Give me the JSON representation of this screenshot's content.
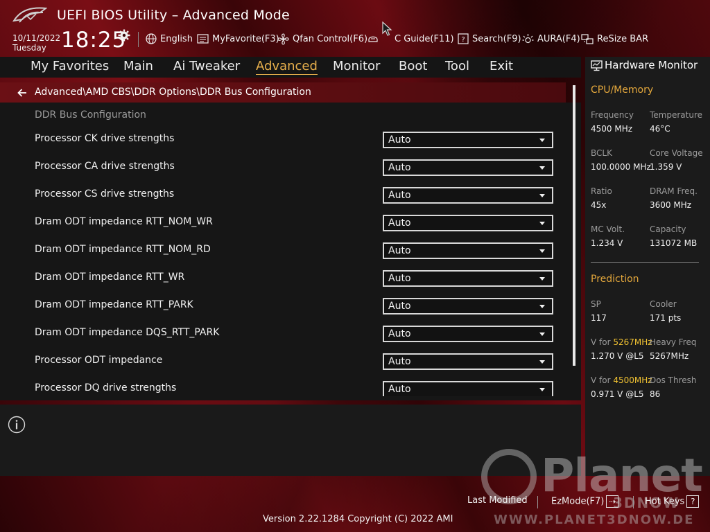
{
  "header": {
    "title": "UEFI BIOS Utility – Advanced Mode",
    "date": "10/11/2022",
    "day": "Tuesday",
    "time": "18:25",
    "tools": [
      {
        "icon": "globe-icon",
        "label": "English"
      },
      {
        "icon": "favorite-icon",
        "label": "MyFavorite(F3)"
      },
      {
        "icon": "fan-icon",
        "label": "Qfan Control(F6)"
      },
      {
        "icon": "oc-guide-icon",
        "label": "C Guide(F11)"
      },
      {
        "icon": "search-icon",
        "label": "Search(F9)"
      },
      {
        "icon": "aura-icon",
        "label": "AURA(F4)"
      },
      {
        "icon": "resize-bar-icon",
        "label": "ReSize BAR"
      }
    ]
  },
  "tabs": [
    {
      "label": "My Favorites",
      "active": false
    },
    {
      "label": "Main",
      "active": false
    },
    {
      "label": "Ai Tweaker",
      "active": false
    },
    {
      "label": "Advanced",
      "active": true
    },
    {
      "label": "Monitor",
      "active": false
    },
    {
      "label": "Boot",
      "active": false
    },
    {
      "label": "Tool",
      "active": false
    },
    {
      "label": "Exit",
      "active": false
    }
  ],
  "breadcrumb": "Advanced\\AMD CBS\\DDR Options\\DDR Bus Configuration",
  "section_title": "DDR Bus Configuration",
  "settings": [
    {
      "label": "Processor CK drive strengths",
      "value": "Auto"
    },
    {
      "label": "Processor CA drive strengths",
      "value": "Auto"
    },
    {
      "label": "Processor CS drive strengths",
      "value": "Auto"
    },
    {
      "label": "Dram ODT impedance RTT_NOM_WR",
      "value": "Auto"
    },
    {
      "label": "Dram ODT impedance RTT_NOM_RD",
      "value": "Auto"
    },
    {
      "label": "Dram ODT impedance RTT_WR",
      "value": "Auto"
    },
    {
      "label": "Dram ODT impedance RTT_PARK",
      "value": "Auto"
    },
    {
      "label": "Dram ODT impedance DQS_RTT_PARK",
      "value": "Auto"
    },
    {
      "label": "Processor ODT impedance",
      "value": "Auto"
    },
    {
      "label": "Processor DQ drive strengths",
      "value": "Auto"
    }
  ],
  "hw_monitor": {
    "title": "Hardware Monitor",
    "cpu_memory_title": "CPU/Memory",
    "cpu_memory": [
      {
        "label": "Frequency",
        "value": "4500 MHz"
      },
      {
        "label": "Temperature",
        "value": "46°C"
      },
      {
        "label": "BCLK",
        "value": "100.0000 MHz"
      },
      {
        "label": "Core Voltage",
        "value": "1.359 V"
      },
      {
        "label": "Ratio",
        "value": "45x"
      },
      {
        "label": "DRAM Freq.",
        "value": "3600 MHz"
      },
      {
        "label": "MC Volt.",
        "value": "1.234 V"
      },
      {
        "label": "Capacity",
        "value": "131072 MB"
      }
    ],
    "prediction_title": "Prediction",
    "prediction": {
      "sp_label": "SP",
      "sp_value": "117",
      "cooler_label": "Cooler",
      "cooler_value": "171 pts",
      "v1_prefix": "V for ",
      "v1_freq": "5267MHz",
      "v1_value": "1.270 V @L5",
      "heavy_label": "Heavy Freq",
      "heavy_value": "5267MHz",
      "v2_prefix": "V for ",
      "v2_freq": "4500MHz",
      "v2_value": "0.971 V @L5",
      "dos_label": "Dos Thresh",
      "dos_value": "86"
    }
  },
  "footer": {
    "last_modified": "Last Modified",
    "ezmode": "EzMode(F7)",
    "hotkeys": "Hot Keys",
    "hotkeys_icon": "?",
    "version": "Version 2.22.1284 Copyright (C) 2022 AMI"
  },
  "watermark": {
    "text": "Planet",
    "sub": "3DNOW",
    "url": "WWW.PLANET3DNOW.DE"
  },
  "colors": {
    "accent": "#e8b04c",
    "highlight": "#f1c232",
    "breadcrumb_bg": "#6b1015"
  }
}
